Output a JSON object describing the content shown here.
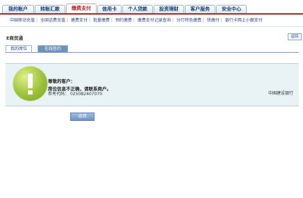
{
  "tabs": [
    {
      "label": "我的账户",
      "active": false
    },
    {
      "label": "转账汇款",
      "active": false
    },
    {
      "label": "缴费支付",
      "active": true
    },
    {
      "label": "信用卡",
      "active": false
    },
    {
      "label": "个人贷款",
      "active": false
    },
    {
      "label": "投资理财",
      "active": false
    },
    {
      "label": "客户服务",
      "active": false
    },
    {
      "label": "安全中心",
      "active": false
    }
  ],
  "subnav": [
    "中国移动充值",
    "全国话费充值",
    "缴费支付",
    "批量缴费",
    "预约缴费",
    "缴费支付记录查询",
    "分行特色缴费",
    "快缴付",
    "银行卡网上小额支付"
  ],
  "section_title": "E商贸通",
  "back_label": "返回",
  "subtabs": [
    {
      "label": "我的席位",
      "active": false
    },
    {
      "label": "在线签约",
      "active": true
    }
  ],
  "message": {
    "greeting": "尊敬的客户：",
    "error": "席位信息不正确，请联系商户。",
    "ref_label": "参考代码：",
    "ref_code": "0250B2407070",
    "bank": "中国建设银行"
  },
  "return_label": "返回",
  "colors": {
    "accent_red": "#b22222",
    "nav_blue": "#274d85",
    "icon_green": "#9cc23a"
  }
}
